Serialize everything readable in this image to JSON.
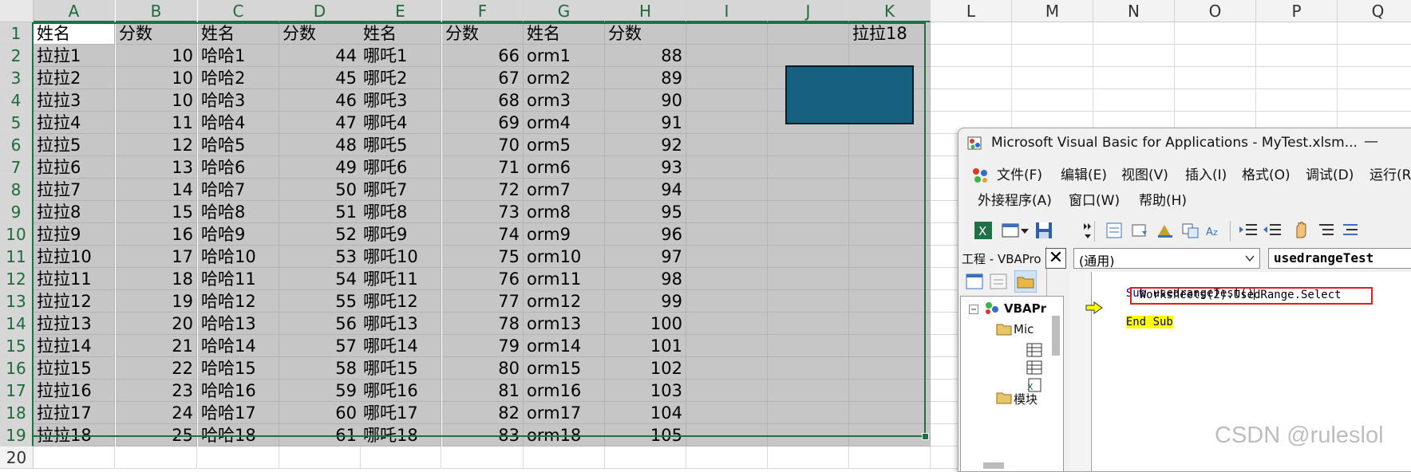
{
  "spreadsheet": {
    "columns": [
      "A",
      "B",
      "C",
      "D",
      "E",
      "F",
      "G",
      "H",
      "I",
      "J",
      "K",
      "L",
      "M",
      "N",
      "O",
      "P",
      "Q"
    ],
    "rows": [
      "1",
      "2",
      "3",
      "4",
      "5",
      "6",
      "7",
      "8",
      "9",
      "10",
      "11",
      "12",
      "13",
      "14",
      "15",
      "16",
      "17",
      "18",
      "19",
      "20"
    ],
    "header_row": [
      "姓名",
      "分数",
      "姓名",
      "分数",
      "姓名",
      "分数",
      "姓名",
      "分数"
    ],
    "k1": "拉拉18",
    "data_rows": [
      [
        "拉拉1",
        "10",
        "哈哈1",
        "44",
        "哪吒1",
        "66",
        "orm1",
        "88"
      ],
      [
        "拉拉2",
        "10",
        "哈哈2",
        "45",
        "哪吒2",
        "67",
        "orm2",
        "89"
      ],
      [
        "拉拉3",
        "10",
        "哈哈3",
        "46",
        "哪吒3",
        "68",
        "orm3",
        "90"
      ],
      [
        "拉拉4",
        "11",
        "哈哈4",
        "47",
        "哪吒4",
        "69",
        "orm4",
        "91"
      ],
      [
        "拉拉5",
        "12",
        "哈哈5",
        "48",
        "哪吒5",
        "70",
        "orm5",
        "92"
      ],
      [
        "拉拉6",
        "13",
        "哈哈6",
        "49",
        "哪吒6",
        "71",
        "orm6",
        "93"
      ],
      [
        "拉拉7",
        "14",
        "哈哈7",
        "50",
        "哪吒7",
        "72",
        "orm7",
        "94"
      ],
      [
        "拉拉8",
        "15",
        "哈哈8",
        "51",
        "哪吒8",
        "73",
        "orm8",
        "95"
      ],
      [
        "拉拉9",
        "16",
        "哈哈9",
        "52",
        "哪吒9",
        "74",
        "orm9",
        "96"
      ],
      [
        "拉拉10",
        "17",
        "哈哈10",
        "53",
        "哪吒10",
        "75",
        "orm10",
        "97"
      ],
      [
        "拉拉11",
        "18",
        "哈哈11",
        "54",
        "哪吒11",
        "76",
        "orm11",
        "98"
      ],
      [
        "拉拉12",
        "19",
        "哈哈12",
        "55",
        "哪吒12",
        "77",
        "orm12",
        "99"
      ],
      [
        "拉拉13",
        "20",
        "哈哈13",
        "56",
        "哪吒13",
        "78",
        "orm13",
        "100"
      ],
      [
        "拉拉14",
        "21",
        "哈哈14",
        "57",
        "哪吒14",
        "79",
        "orm14",
        "101"
      ],
      [
        "拉拉15",
        "22",
        "哈哈15",
        "58",
        "哪吒15",
        "80",
        "orm15",
        "102"
      ],
      [
        "拉拉16",
        "23",
        "哈哈16",
        "59",
        "哪吒16",
        "81",
        "orm16",
        "103"
      ],
      [
        "拉拉17",
        "24",
        "哈哈17",
        "60",
        "哪吒17",
        "82",
        "orm17",
        "104"
      ],
      [
        "拉拉18",
        "25",
        "哈哈18",
        "61",
        "哪吒18",
        "83",
        "orm18",
        "105"
      ]
    ],
    "shape_color": "#17607f",
    "selection_color": "#1e7145"
  },
  "vba": {
    "title": "Microsoft Visual Basic for Applications - MyTest.xlsm...",
    "minimize": "—",
    "menu_row1": [
      "文件(F)",
      "编辑(E)",
      "视图(V)",
      "插入(I)",
      "格式(O)",
      "调试(D)",
      "运行(R"
    ],
    "menu_row2": [
      "外接程序(A)",
      "窗口(W)",
      "帮助(H)"
    ],
    "project_title": "工程 - VBAPro",
    "close_glyph": "✕",
    "tree": [
      "VBAPr",
      "Mic",
      "模块"
    ],
    "combo_object": "(通用)",
    "combo_proc": "usedrangeTest",
    "code": {
      "line1_kw": "Sub",
      "line1_rest": " usedrangeTest()",
      "line2": "    Worksheets(2).UsedRange.Select",
      "line3": "End Sub"
    }
  },
  "watermark": "CSDN @ruleslol"
}
